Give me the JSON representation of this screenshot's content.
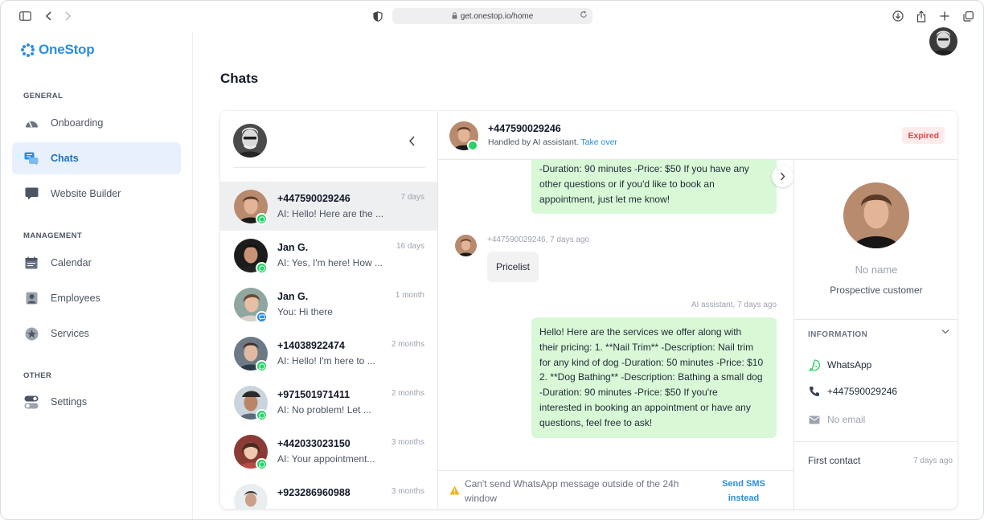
{
  "browser": {
    "url": "get.onestop.io/home"
  },
  "brand": {
    "name": "OneStop",
    "color": "#2b8de0"
  },
  "sidebar": {
    "sections": [
      {
        "label": "GENERAL"
      },
      {
        "label": "MANAGEMENT"
      },
      {
        "label": "OTHER"
      }
    ],
    "items": [
      {
        "label": "Onboarding",
        "icon": "gauge-icon"
      },
      {
        "label": "Chats",
        "icon": "chat-bubbles-icon",
        "active": true
      },
      {
        "label": "Website Builder",
        "icon": "monitor-icon"
      },
      {
        "label": "Calendar",
        "icon": "calendar-icon"
      },
      {
        "label": "Employees",
        "icon": "person-icon"
      },
      {
        "label": "Services",
        "icon": "star-badge-icon"
      },
      {
        "label": "Settings",
        "icon": "toggles-icon"
      }
    ]
  },
  "page": {
    "title": "Chats"
  },
  "chats": [
    {
      "name": "+447590029246",
      "time": "7 days",
      "preview": "AI: Hello! Here are the ...",
      "channel": "whatsapp",
      "selected": true
    },
    {
      "name": "Jan G.",
      "time": "16 days",
      "preview": "AI: Yes, I'm here! How ...",
      "channel": "whatsapp"
    },
    {
      "name": "Jan G.",
      "time": "1 month",
      "preview": "You: Hi there",
      "channel": "sms"
    },
    {
      "name": "+14038922474",
      "time": "2 months",
      "preview": "AI: Hello! I'm here to ...",
      "channel": "whatsapp"
    },
    {
      "name": "+971501971411",
      "time": "2 months",
      "preview": "AI: No problem! Let ...",
      "channel": "whatsapp"
    },
    {
      "name": "+442033023150",
      "time": "3 months",
      "preview": "AI: Your appointment...",
      "channel": "whatsapp"
    },
    {
      "name": "+923286960988",
      "time": "3 months",
      "preview": "",
      "channel": "whatsapp"
    }
  ],
  "conversation": {
    "contact": "+447590029246",
    "handled_by": "Handled by AI assistant.",
    "take_over": "Take over",
    "status": "Expired",
    "messages": [
      {
        "from": "ai",
        "lines": [
          "-Duration: 90 minutes -Price: $50 If you have any",
          "other questions or if you'd like to book an",
          "appointment, just let me know!"
        ]
      },
      {
        "from": "user",
        "meta": "+447590029246, 7 days ago",
        "text": "Pricelist"
      },
      {
        "from": "ai",
        "meta": "AI assistant, 7 days ago",
        "lines": [
          "Hello! Here are the services we offer along with",
          "their pricing: 1. **Nail Trim** -Description: Nail trim",
          "for any kind of dog -Duration: 50 minutes -Price: $10",
          "2. **Dog Bathing** -Description: Bathing a small dog",
          "-Duration: 90 minutes -Price: $50 If you're",
          "interested in booking an appointment or have any",
          "questions, feel free to ask!"
        ]
      }
    ],
    "composer_notice": "Can't send WhatsApp message outside of the 24h window",
    "send_sms": "Send SMS instead"
  },
  "contact_info": {
    "name": "No name",
    "role": "Prospective customer",
    "section_label": "INFORMATION",
    "channel": "WhatsApp",
    "phone": "+447590029246",
    "email": "No email",
    "first_contact_label": "First contact",
    "first_contact_value": "7 days ago"
  }
}
